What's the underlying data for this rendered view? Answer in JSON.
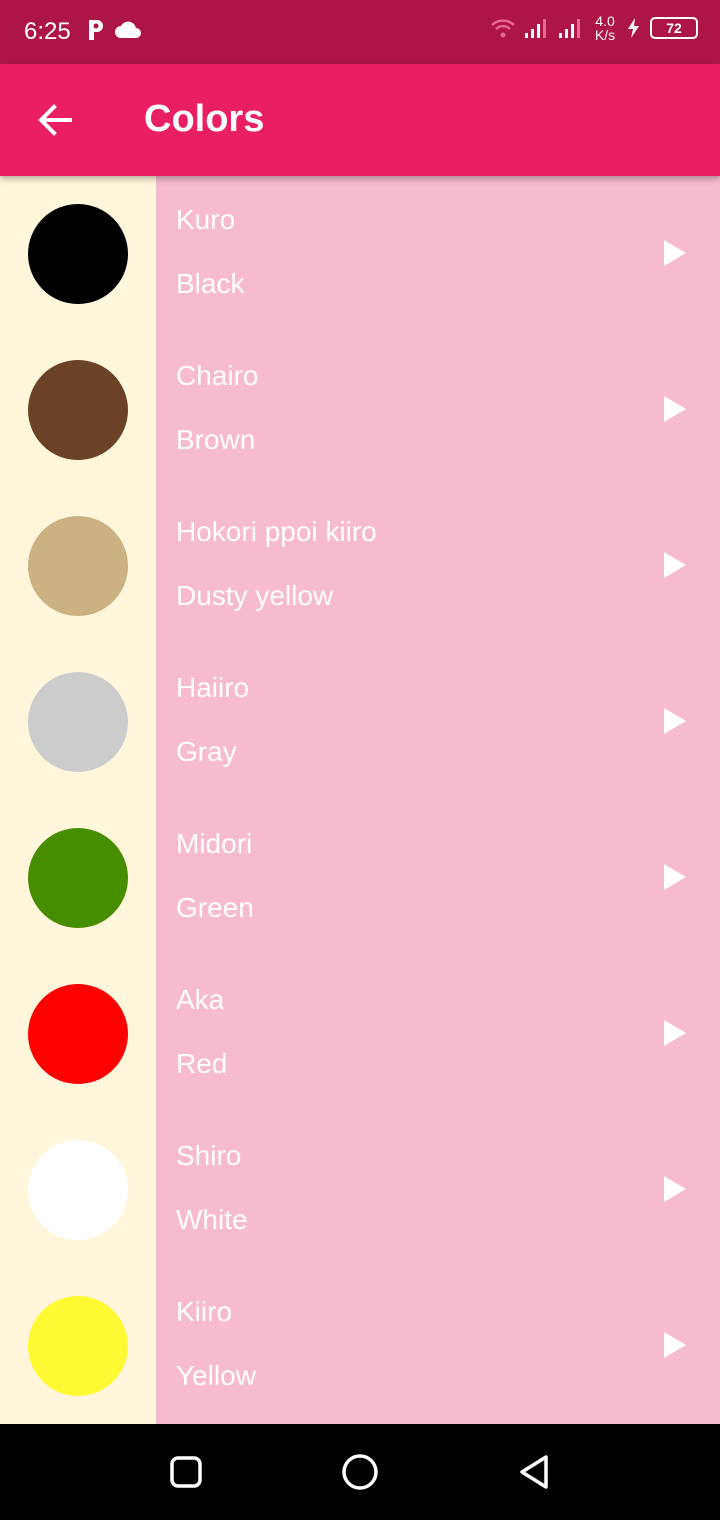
{
  "status_bar": {
    "time": "6:25",
    "speed_top": "4.0",
    "speed_bottom": "K/s",
    "battery": "72",
    "icons": [
      "parking-app-icon",
      "cloud-icon",
      "wifi-icon",
      "signal-icon",
      "signal-icon",
      "charging-icon",
      "battery-icon"
    ]
  },
  "app_bar": {
    "title": "Colors",
    "back_icon": "arrow-left-icon"
  },
  "colors": [
    {
      "japanese": "Kuro",
      "english": "Black",
      "swatch": "#000000"
    },
    {
      "japanese": "Chairo",
      "english": "Brown",
      "swatch": "#6b4226"
    },
    {
      "japanese": "Hokori ppoi kiiro",
      "english": "Dusty yellow",
      "swatch": "#ccb183"
    },
    {
      "japanese": "Haiiro",
      "english": "Gray",
      "swatch": "#cccccc"
    },
    {
      "japanese": "Midori",
      "english": "Green",
      "swatch": "#478d00"
    },
    {
      "japanese": "Aka",
      "english": "Red",
      "swatch": "#ff0000"
    },
    {
      "japanese": "Shiro",
      "english": "White",
      "swatch": "#ffffff"
    },
    {
      "japanese": "Kiiro",
      "english": "Yellow",
      "swatch": "#fff933"
    }
  ],
  "theme": {
    "status_bar": "#ad1547",
    "app_bar": "#e91e63",
    "list_background": "#f7bbd0",
    "swatch_background": "#fff6dc"
  },
  "nav_bar": {
    "icons": [
      "recents-square-icon",
      "home-circle-icon",
      "back-triangle-icon"
    ]
  }
}
